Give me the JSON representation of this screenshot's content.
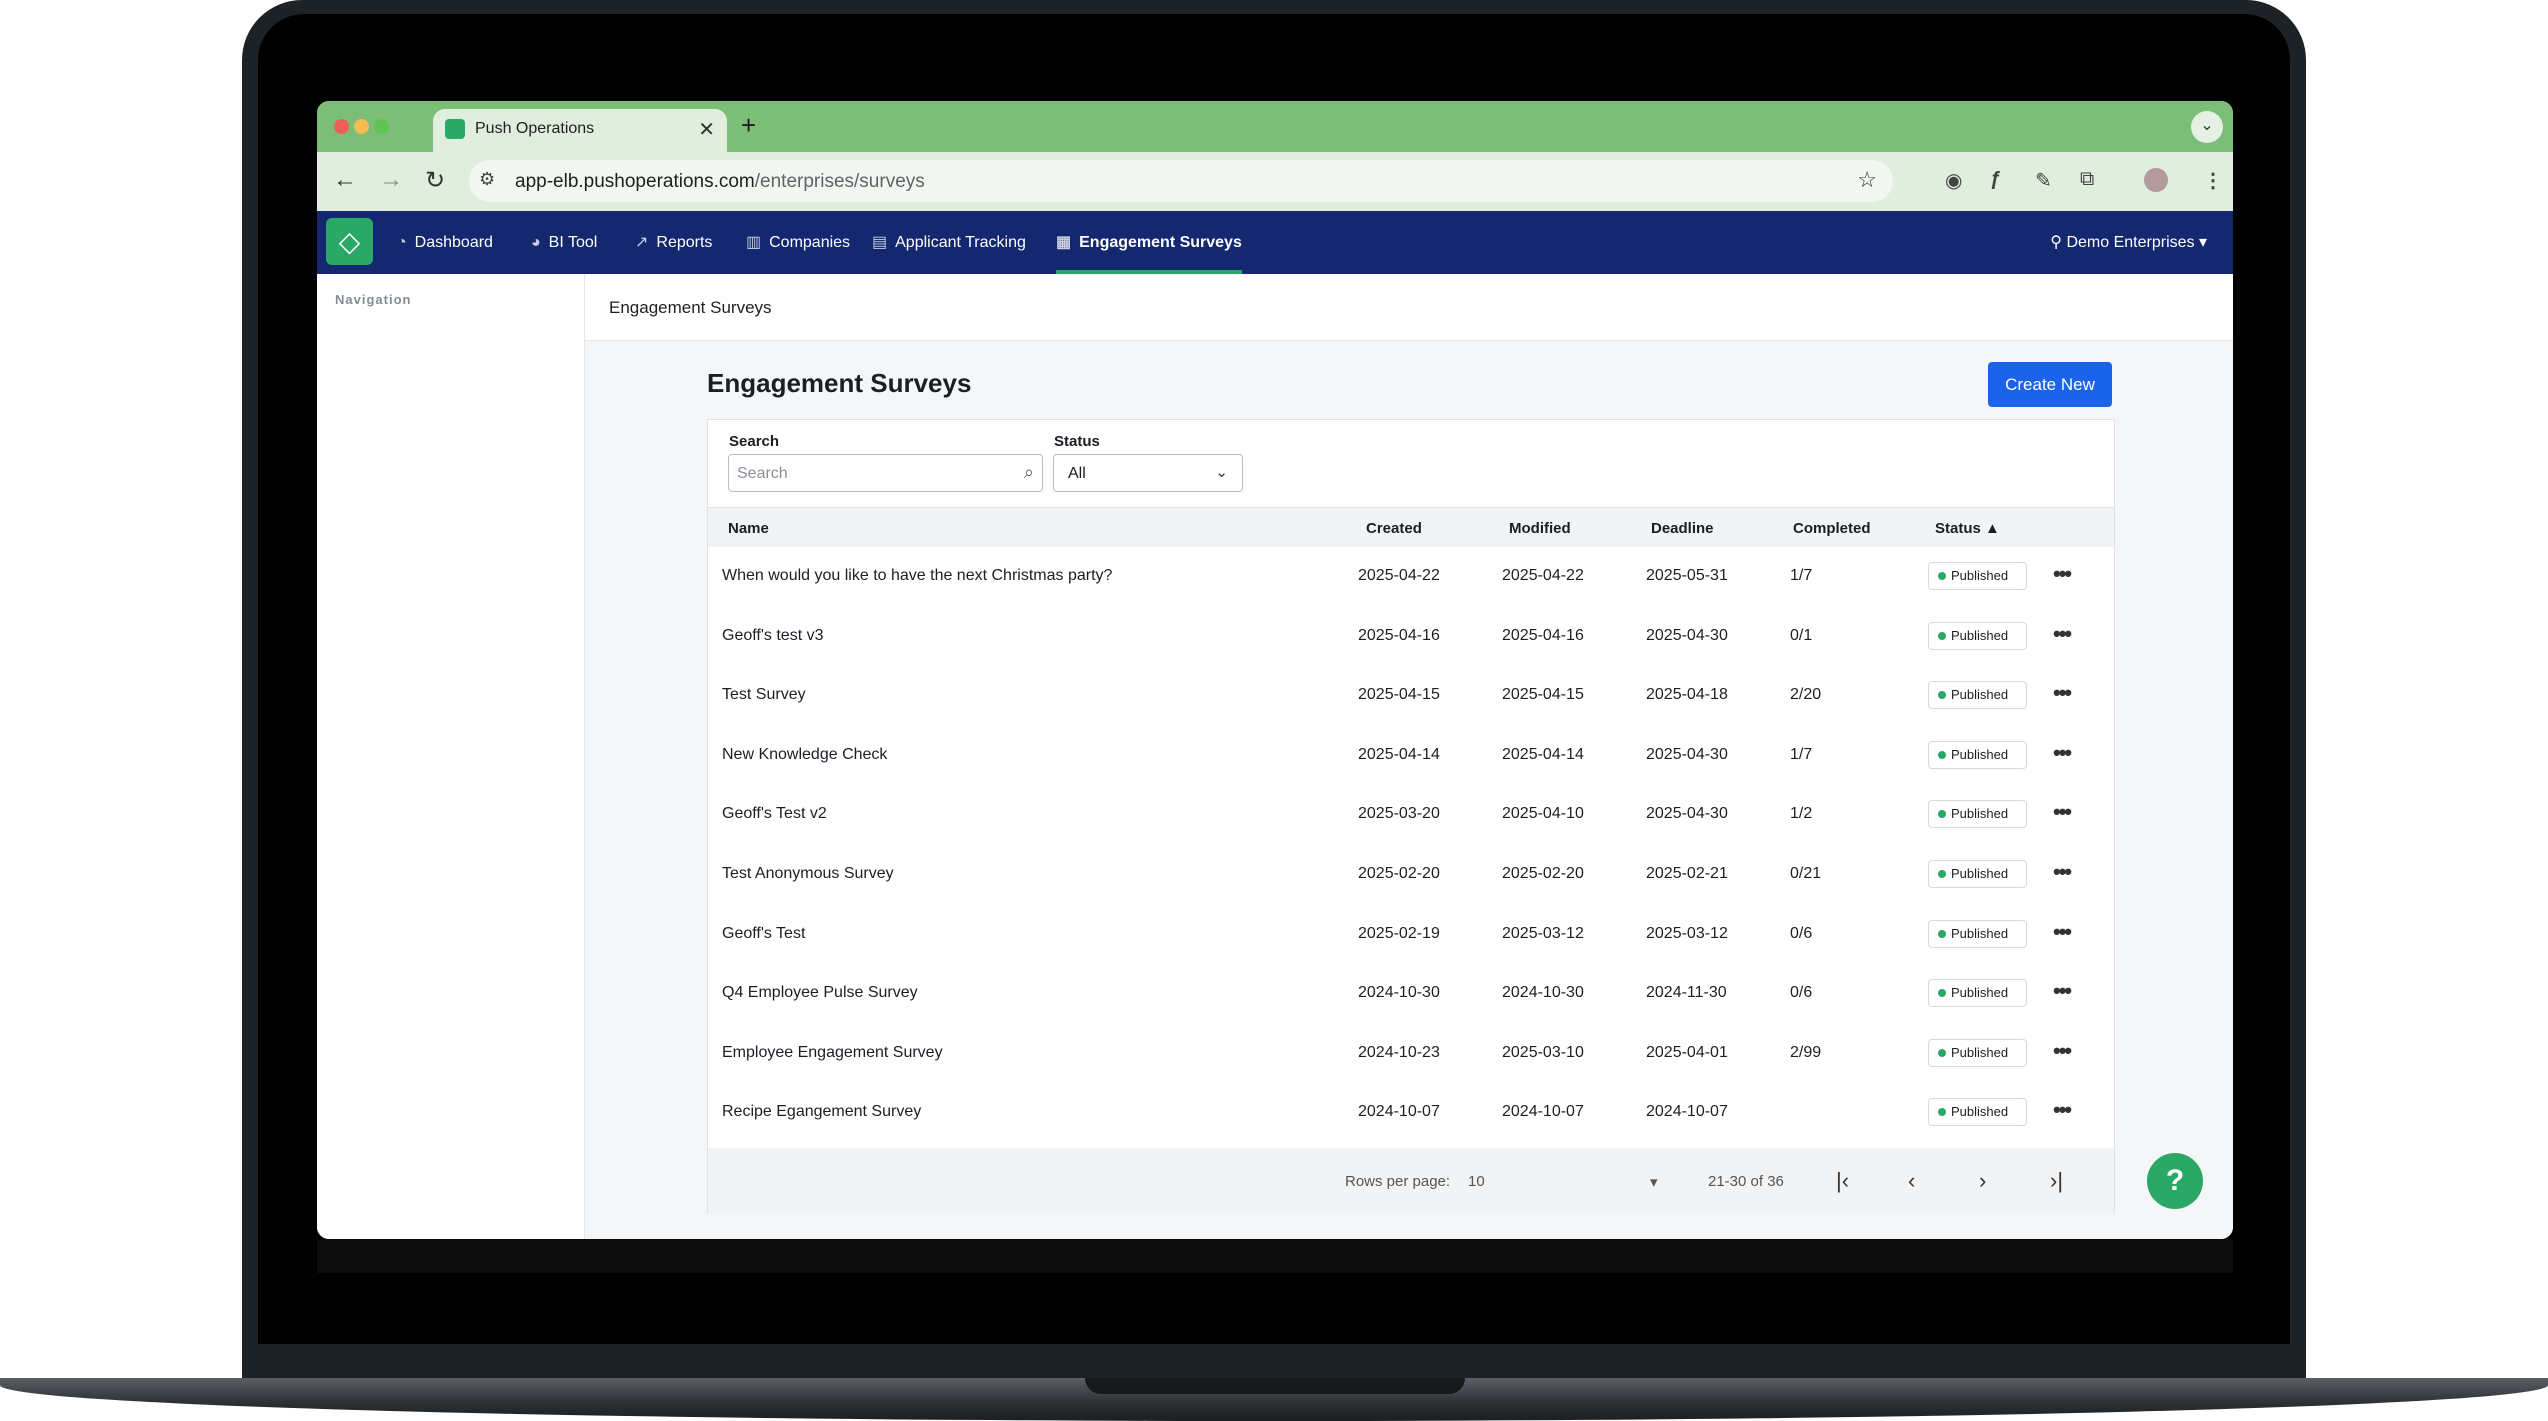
{
  "browser": {
    "tab_title": "Push Operations",
    "tab_close": "✕",
    "new_tab": "+",
    "url_host": "app-elb.pushoperations.com",
    "url_path": "/enterprises/surveys"
  },
  "nav": {
    "items": [
      {
        "label": "Dashboard"
      },
      {
        "label": "BI Tool"
      },
      {
        "label": "Reports"
      },
      {
        "label": "Companies"
      },
      {
        "label": "Applicant Tracking"
      },
      {
        "label": "Engagement Surveys"
      }
    ],
    "active": "Engagement Surveys",
    "enterprise": "Demo Enterprises"
  },
  "sidebar": {
    "title": "Navigation"
  },
  "breadcrumb": "Engagement Surveys",
  "page": {
    "title": "Engagement Surveys",
    "create_label": "Create New"
  },
  "filters": {
    "search_label": "Search",
    "search_placeholder": "Search",
    "status_label": "Status",
    "status_value": "All"
  },
  "table": {
    "columns": [
      "Name",
      "Created",
      "Modified",
      "Deadline",
      "Completed",
      "Status ▲"
    ],
    "rows": [
      {
        "name": "When would you like to have the next Christmas party?",
        "created": "2025-04-22",
        "modified": "2025-04-22",
        "deadline": "2025-05-31",
        "completed": "1/7",
        "status": "Published"
      },
      {
        "name": "Geoff's test v3",
        "created": "2025-04-16",
        "modified": "2025-04-16",
        "deadline": "2025-04-30",
        "completed": "0/1",
        "status": "Published"
      },
      {
        "name": "Test Survey",
        "created": "2025-04-15",
        "modified": "2025-04-15",
        "deadline": "2025-04-18",
        "completed": "2/20",
        "status": "Published"
      },
      {
        "name": "New Knowledge Check",
        "created": "2025-04-14",
        "modified": "2025-04-14",
        "deadline": "2025-04-30",
        "completed": "1/7",
        "status": "Published"
      },
      {
        "name": "Geoff's Test v2",
        "created": "2025-03-20",
        "modified": "2025-04-10",
        "deadline": "2025-04-30",
        "completed": "1/2",
        "status": "Published"
      },
      {
        "name": "Test Anonymous Survey",
        "created": "2025-02-20",
        "modified": "2025-02-20",
        "deadline": "2025-02-21",
        "completed": "0/21",
        "status": "Published"
      },
      {
        "name": "Geoff's Test",
        "created": "2025-02-19",
        "modified": "2025-03-12",
        "deadline": "2025-03-12",
        "completed": "0/6",
        "status": "Published"
      },
      {
        "name": "Q4 Employee Pulse Survey",
        "created": "2024-10-30",
        "modified": "2024-10-30",
        "deadline": "2024-11-30",
        "completed": "0/6",
        "status": "Published"
      },
      {
        "name": "Employee Engagement Survey",
        "created": "2024-10-23",
        "modified": "2025-03-10",
        "deadline": "2025-04-01",
        "completed": "2/99",
        "status": "Published"
      },
      {
        "name": "Recipe Egangement Survey",
        "created": "2024-10-07",
        "modified": "2024-10-07",
        "deadline": "2024-10-07",
        "completed": "",
        "status": "Published"
      }
    ],
    "more_icon": "•••"
  },
  "pagination": {
    "rows_per_page_label": "Rows per page:",
    "rows_per_page_value": "10",
    "range": "21-30 of 36"
  },
  "colors": {
    "nav_bg": "#142870",
    "accent_green": "#2aa866",
    "primary_button": "#1b63e8"
  }
}
